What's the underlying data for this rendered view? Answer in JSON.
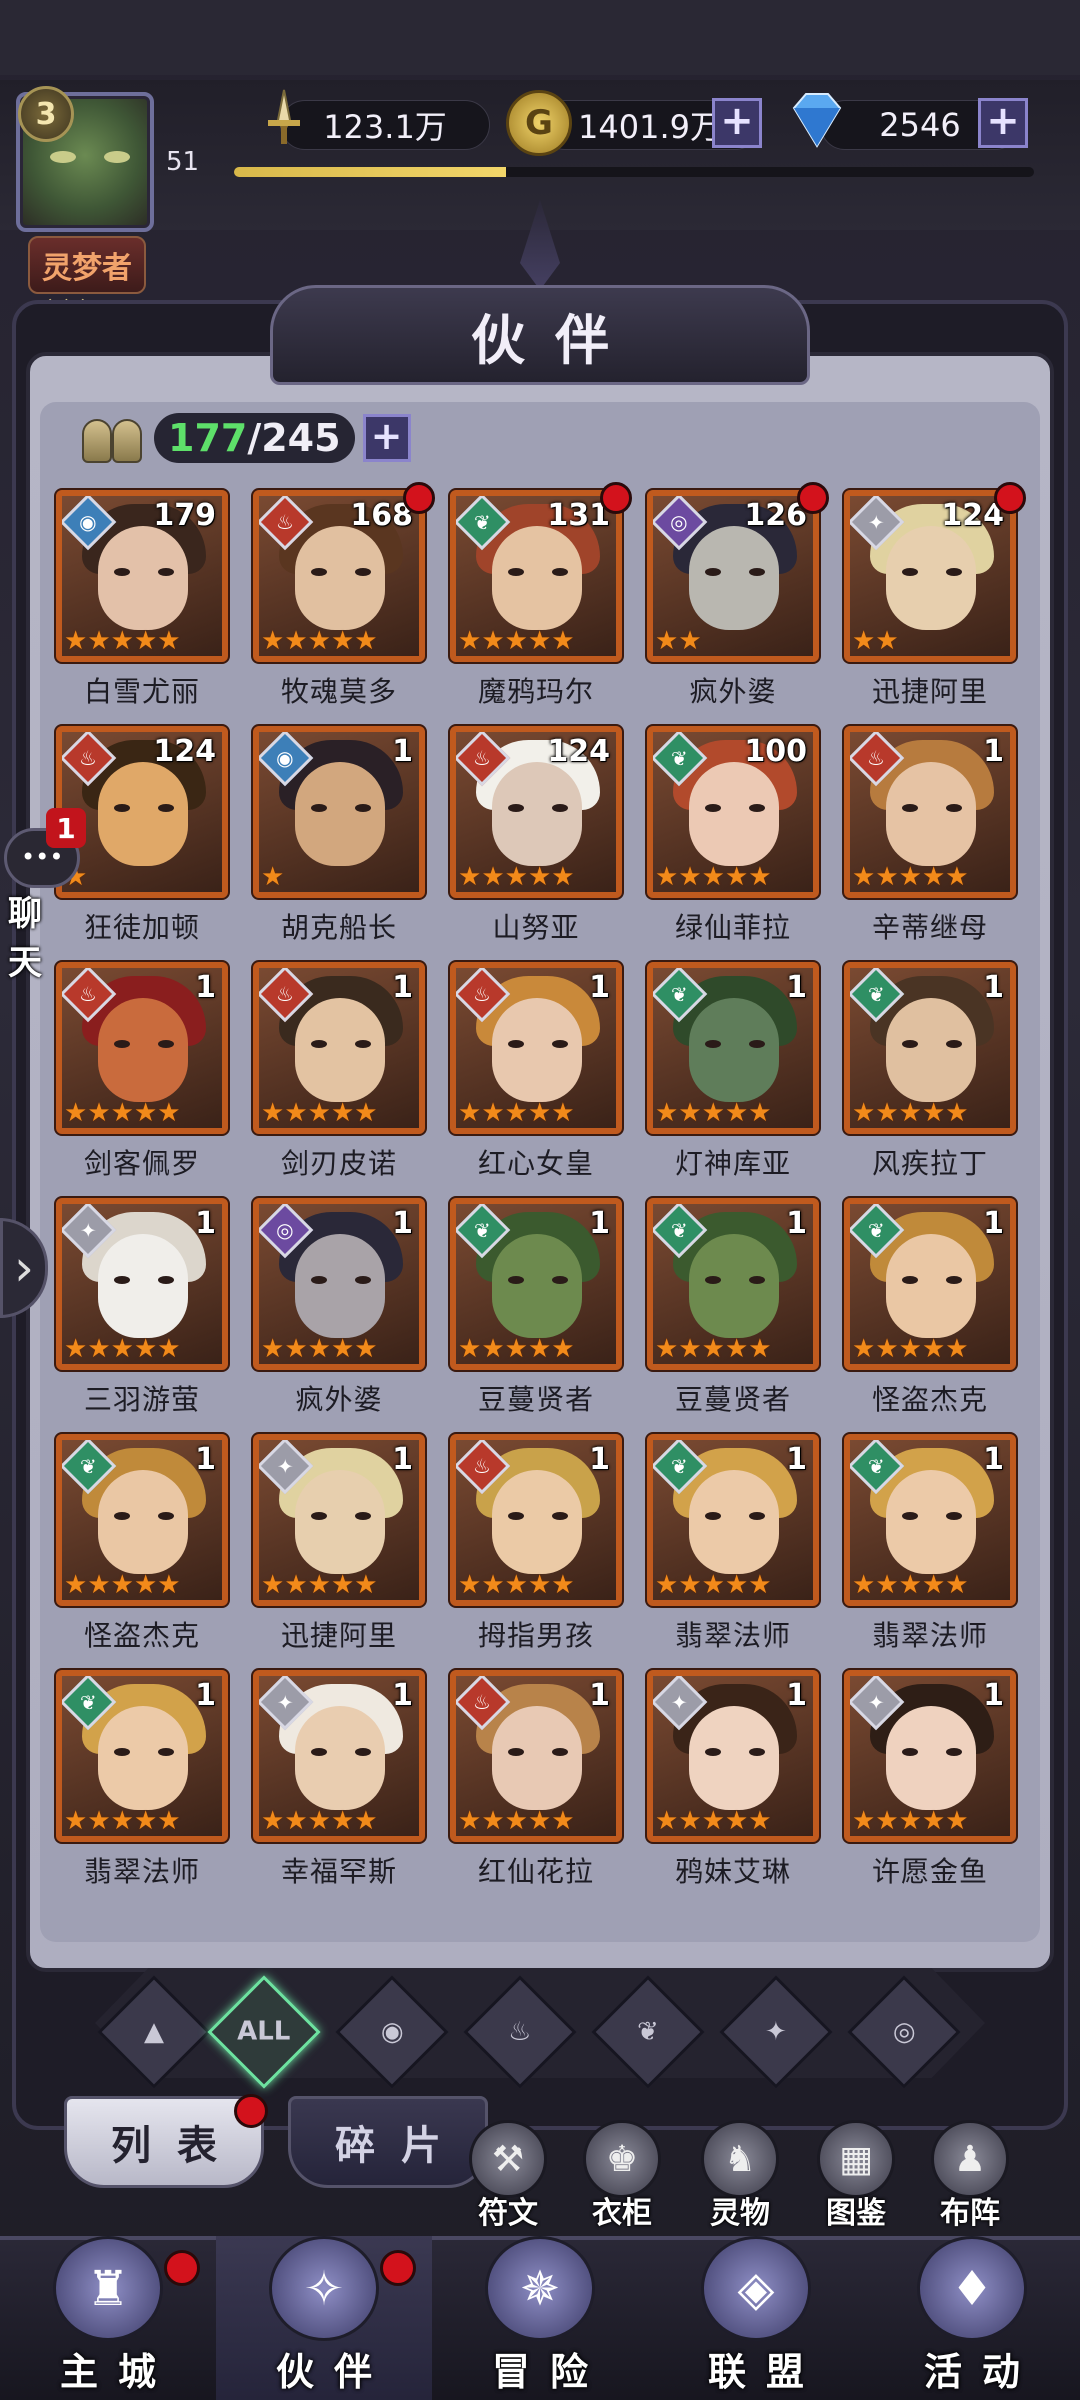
{
  "player": {
    "vip_level": "3",
    "level": "51",
    "rank_label": "灵梦者",
    "rank_pips": "◆◆◆",
    "exp_progress": 0.34
  },
  "resources": {
    "power": "123.1万",
    "gold": "1401.9万",
    "diamonds": "2546",
    "power_icon": "sword-icon",
    "gold_icon": "gold-coin-icon",
    "diamond_icon": "diamond-icon"
  },
  "page": {
    "title": "伙伴"
  },
  "roster": {
    "owned": "177",
    "separator": "/",
    "capacity": "245"
  },
  "heroes": [
    {
      "name": "白雪尤丽",
      "level": "179",
      "element": "water",
      "stars": 5,
      "dot": false,
      "portrait": "#e3c1a9",
      "hair": "#3a261d"
    },
    {
      "name": "牧魂莫多",
      "level": "168",
      "element": "fire",
      "stars": 5,
      "dot": true,
      "portrait": "#e1c0a0",
      "hair": "#5a3620"
    },
    {
      "name": "魔鸦玛尔",
      "level": "131",
      "element": "nature",
      "stars": 5,
      "dot": true,
      "portrait": "#e5c3a2",
      "hair": "#a0442a"
    },
    {
      "name": "疯外婆",
      "level": "126",
      "element": "shadow",
      "stars": 2,
      "dot": true,
      "portrait": "#b9b7b0",
      "hair": "#2a2838"
    },
    {
      "name": "迅捷阿里",
      "level": "124",
      "element": "light",
      "stars": 2,
      "dot": true,
      "portrait": "#e7cfae",
      "hair": "#e0d2a0"
    },
    {
      "name": "狂徒加顿",
      "level": "124",
      "element": "fire",
      "stars": 1,
      "dot": false,
      "portrait": "#e0a868",
      "hair": "#3a2614"
    },
    {
      "name": "胡克船长",
      "level": "1",
      "element": "water",
      "stars": 1,
      "dot": false,
      "portrait": "#d2a77e",
      "hair": "#2a2026"
    },
    {
      "name": "山努亚",
      "level": "124",
      "element": "fire",
      "stars": 5,
      "dot": false,
      "portrait": "#ddc8b8",
      "hair": "#f2f0ea"
    },
    {
      "name": "绿仙菲拉",
      "level": "100",
      "element": "nature",
      "stars": 5,
      "dot": false,
      "portrait": "#ecc9b4",
      "hair": "#b24a2c"
    },
    {
      "name": "辛蒂继母",
      "level": "1",
      "element": "fire",
      "stars": 5,
      "dot": false,
      "portrait": "#e6c3a4",
      "hair": "#b77b3e"
    },
    {
      "name": "剑客佩罗",
      "level": "1",
      "element": "fire",
      "stars": 5,
      "dot": false,
      "portrait": "#c96b3d",
      "hair": "#8a1e1e"
    },
    {
      "name": "剑刃皮诺",
      "level": "1",
      "element": "fire",
      "stars": 5,
      "dot": false,
      "portrait": "#e3c3a2",
      "hair": "#3a2a1e"
    },
    {
      "name": "红心女皇",
      "level": "1",
      "element": "fire",
      "stars": 5,
      "dot": false,
      "portrait": "#e8c8ae",
      "hair": "#c9893a"
    },
    {
      "name": "灯神库亚",
      "level": "1",
      "element": "nature",
      "stars": 5,
      "dot": false,
      "portrait": "#5f7d5a",
      "hair": "#2f4a2a"
    },
    {
      "name": "风疾拉丁",
      "level": "1",
      "element": "nature",
      "stars": 5,
      "dot": false,
      "portrait": "#e0c0a0",
      "hair": "#4a3424"
    },
    {
      "name": "三羽游萤",
      "level": "1",
      "element": "light",
      "stars": 5,
      "dot": false,
      "portrait": "#f0eeea",
      "hair": "#dcd6cc"
    },
    {
      "name": "疯外婆",
      "level": "1",
      "element": "shadow",
      "stars": 5,
      "dot": false,
      "portrait": "#a9a3a8",
      "hair": "#2a2838"
    },
    {
      "name": "豆蔓贤者",
      "level": "1",
      "element": "nature",
      "stars": 5,
      "dot": false,
      "portrait": "#6d8a4e",
      "hair": "#3b5a2e"
    },
    {
      "name": "豆蔓贤者",
      "level": "1",
      "element": "nature",
      "stars": 5,
      "dot": false,
      "portrait": "#6d8a4e",
      "hair": "#3b5a2e"
    },
    {
      "name": "怪盗杰克",
      "level": "1",
      "element": "nature",
      "stars": 5,
      "dot": false,
      "portrait": "#eac7a4",
      "hair": "#c08a3a"
    },
    {
      "name": "怪盗杰克",
      "level": "1",
      "element": "nature",
      "stars": 5,
      "dot": false,
      "portrait": "#eac7a4",
      "hair": "#c08a3a"
    },
    {
      "name": "迅捷阿里",
      "level": "1",
      "element": "light",
      "stars": 5,
      "dot": false,
      "portrait": "#e7cfae",
      "hair": "#e0d2a0"
    },
    {
      "name": "拇指男孩",
      "level": "1",
      "element": "fire",
      "stars": 5,
      "dot": false,
      "portrait": "#ebcaa6",
      "hair": "#c9a24a"
    },
    {
      "name": "翡翠法师",
      "level": "1",
      "element": "nature",
      "stars": 5,
      "dot": false,
      "portrait": "#eccaa8",
      "hair": "#d2a24a"
    },
    {
      "name": "翡翠法师",
      "level": "1",
      "element": "nature",
      "stars": 5,
      "dot": false,
      "portrait": "#eccaa8",
      "hair": "#d2a24a"
    },
    {
      "name": "翡翠法师",
      "level": "1",
      "element": "nature",
      "stars": 5,
      "dot": false,
      "portrait": "#eccaa8",
      "hair": "#d2a24a"
    },
    {
      "name": "幸福罕斯",
      "level": "1",
      "element": "light",
      "stars": 5,
      "dot": false,
      "portrait": "#e9cdb0",
      "hair": "#efe9e0"
    },
    {
      "name": "红仙花拉",
      "level": "1",
      "element": "fire",
      "stars": 5,
      "dot": false,
      "portrait": "#e8c9b4",
      "hair": "#b8834a"
    },
    {
      "name": "鸦妹艾琳",
      "level": "1",
      "element": "light",
      "stars": 5,
      "dot": false,
      "portrait": "#efd3c0",
      "hair": "#3a2418"
    },
    {
      "name": "许愿金鱼",
      "level": "1",
      "element": "light",
      "stars": 5,
      "dot": false,
      "portrait": "#efd2bf",
      "hair": "#2e1e16"
    }
  ],
  "element_colors": {
    "water": "#3d7fb8",
    "fire": "#b8392b",
    "nature": "#2f8f64",
    "shadow": "#6c4aa0",
    "light": "#9c9ca8"
  },
  "element_glyphs": {
    "water": "◉",
    "fire": "♨",
    "nature": "❦",
    "shadow": "◎",
    "light": "✦"
  },
  "filters": [
    {
      "name": "filter-all-elements-icon",
      "label": "",
      "glyph": "▲",
      "active": false
    },
    {
      "name": "filter-all-button",
      "label": "ALL",
      "glyph": "",
      "active": true
    },
    {
      "name": "filter-water-icon",
      "label": "",
      "glyph": "◉",
      "active": false
    },
    {
      "name": "filter-fire-icon",
      "label": "",
      "glyph": "♨",
      "active": false
    },
    {
      "name": "filter-nature-icon",
      "label": "",
      "glyph": "❦",
      "active": false
    },
    {
      "name": "filter-light-icon",
      "label": "",
      "glyph": "✦",
      "active": false
    },
    {
      "name": "filter-shadow-icon",
      "label": "",
      "glyph": "◎",
      "active": false
    }
  ],
  "tabs": {
    "list": "列表",
    "fragments": "碎片"
  },
  "shortcuts": [
    {
      "label": "符文",
      "icon": "rune-icon",
      "glyph": "⚒"
    },
    {
      "label": "衣柜",
      "icon": "wardrobe-icon",
      "glyph": "♚"
    },
    {
      "label": "灵物",
      "icon": "spirit-item-icon",
      "glyph": "♞"
    },
    {
      "label": "图鉴",
      "icon": "codex-icon",
      "glyph": "▦"
    },
    {
      "label": "布阵",
      "icon": "formation-icon",
      "glyph": "♟"
    }
  ],
  "chat": {
    "label": "聊天",
    "unread": "1"
  },
  "nav": [
    {
      "label": "主城",
      "icon": "castle-icon",
      "glyph": "♜",
      "dot": true,
      "active": false
    },
    {
      "label": "伙伴",
      "icon": "wizard-hat-icon",
      "glyph": "✧",
      "dot": true,
      "active": true
    },
    {
      "label": "冒险",
      "icon": "compass-icon",
      "glyph": "✵",
      "dot": false,
      "active": false
    },
    {
      "label": "联盟",
      "icon": "shield-icon",
      "glyph": "◈",
      "dot": false,
      "active": false
    },
    {
      "label": "活动",
      "icon": "cards-icon",
      "glyph": "♦",
      "dot": false,
      "active": false
    }
  ],
  "ui": {
    "plus": "+",
    "side_arrow": "›"
  }
}
